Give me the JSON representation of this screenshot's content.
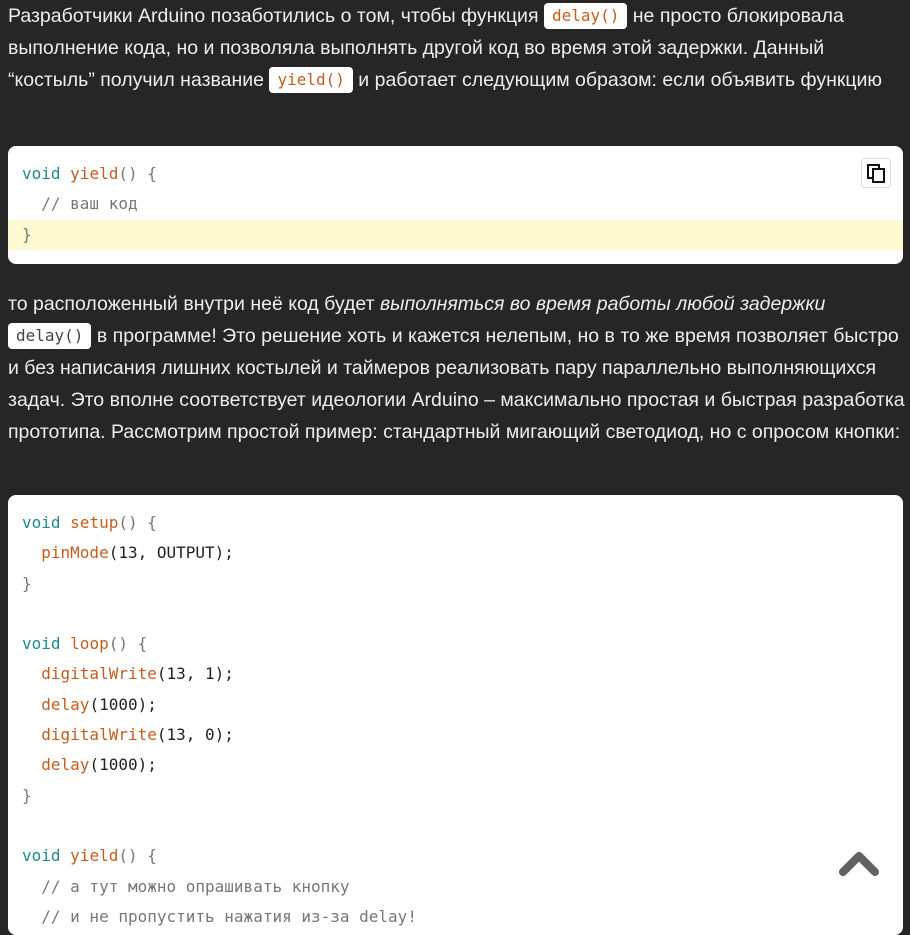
{
  "para1": {
    "t1": "Разработчики Arduino позаботились о том, чтобы функция ",
    "c1": "delay()",
    "t2": " не просто блокировала выполнение кода, но и позволяла выполнять другой код во время этой задержки. Данный “костыль” получил название ",
    "c2": "yield()",
    "t3": " и работает следующим образом: если объявить функцию"
  },
  "code1": {
    "lines": [
      [
        "void",
        " ",
        "yield",
        "() {"
      ],
      [
        "  // ваш код"
      ],
      [
        "}"
      ]
    ],
    "copy_icon": "copy-icon"
  },
  "para2": {
    "t1": "то расположенный внутри неё код будет ",
    "em": "выполняться во время работы любой задержки",
    "t2": " ",
    "c1": "delay()",
    "t3": " в программе! Это решение хоть и кажется нелепым, но в то же время позволяет быстро и без написания лишних костылей и таймеров реализовать пару параллельно выполняющихся задач. Это вполне соответствует идеологии Arduino – максимально простая и быстрая разработка прототипа. Рассмотрим простой пример: стандартный мигающий светодиод, но с опросом кнопки:"
  },
  "code2": {
    "l1_kw": "void",
    "l1_fn": "setup",
    "l1_rest": "() {",
    "l2_fn": "pinMode",
    "l2_rest": "(13, OUTPUT);",
    "l3": "}",
    "l5_kw": "void",
    "l5_fn": "loop",
    "l5_rest": "() {",
    "l6_fn": "digitalWrite",
    "l6_rest": "(13, 1);",
    "l7_fn": "delay",
    "l7_rest": "(1000);",
    "l8_fn": "digitalWrite",
    "l8_rest": "(13, 0);",
    "l9_fn": "delay",
    "l9_rest": "(1000);",
    "l10": "}",
    "l12_kw": "void",
    "l12_fn": "yield",
    "l12_rest": "() {",
    "l13": "  // а тут можно опрашивать кнопку",
    "l14": "  // и не пропустить нажатия из-за delay!"
  },
  "scroll_top_icon": "chevron-up-icon"
}
